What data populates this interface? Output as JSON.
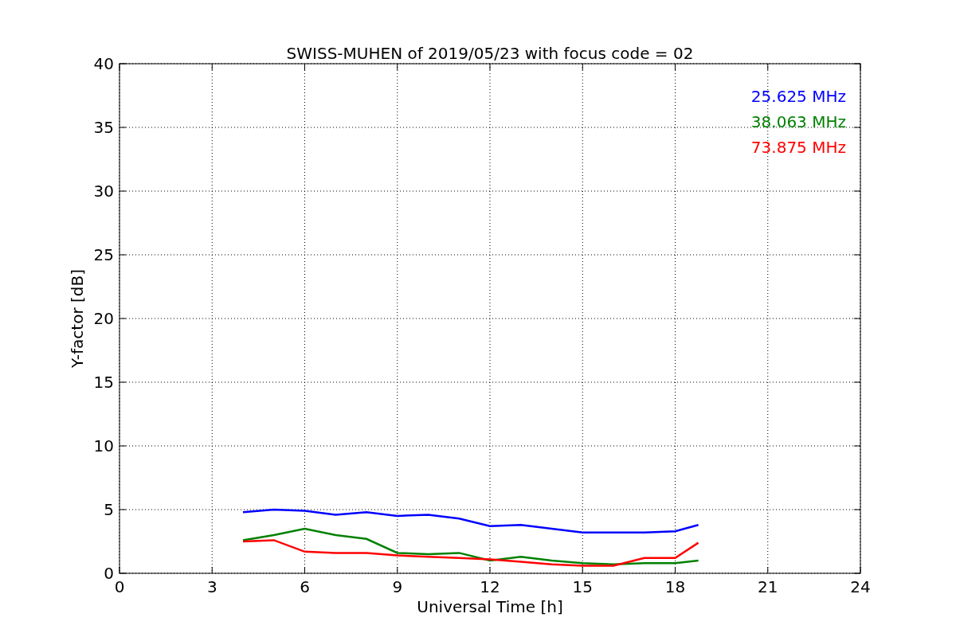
{
  "figure": {
    "chart_data": {
      "type": "line",
      "title": "SWISS-MUHEN of 2019/05/23 with focus code = 02",
      "xlabel": "Universal Time [h]",
      "ylabel": "Y-factor [dB]",
      "x": [
        4,
        5,
        6,
        7,
        8,
        9,
        10,
        11,
        12,
        13,
        14,
        15,
        16,
        17,
        18,
        18.75
      ],
      "series": [
        {
          "name": "25.625 MHz",
          "color": "#0000ff",
          "values": [
            4.8,
            5.0,
            4.9,
            4.6,
            4.8,
            4.5,
            4.6,
            4.3,
            3.7,
            3.8,
            3.5,
            3.2,
            3.2,
            3.2,
            3.3,
            3.8
          ]
        },
        {
          "name": "38.063 MHz",
          "color": "#008000",
          "values": [
            2.6,
            3.0,
            3.5,
            3.0,
            2.7,
            1.6,
            1.5,
            1.6,
            1.0,
            1.3,
            1.0,
            0.8,
            0.7,
            0.8,
            0.8,
            1.0
          ]
        },
        {
          "name": "73.875 MHz",
          "color": "#ff0000",
          "values": [
            2.5,
            2.6,
            1.7,
            1.6,
            1.6,
            1.4,
            1.3,
            1.2,
            1.1,
            0.9,
            0.7,
            0.6,
            0.6,
            1.2,
            1.2,
            2.4
          ]
        }
      ],
      "xlim": [
        0,
        24
      ],
      "ylim": [
        0,
        40
      ],
      "xticks": [
        0,
        3,
        6,
        9,
        12,
        15,
        18,
        21,
        24
      ],
      "yticks": [
        0,
        5,
        10,
        15,
        20,
        25,
        30,
        35,
        40
      ],
      "grid": true
    }
  }
}
